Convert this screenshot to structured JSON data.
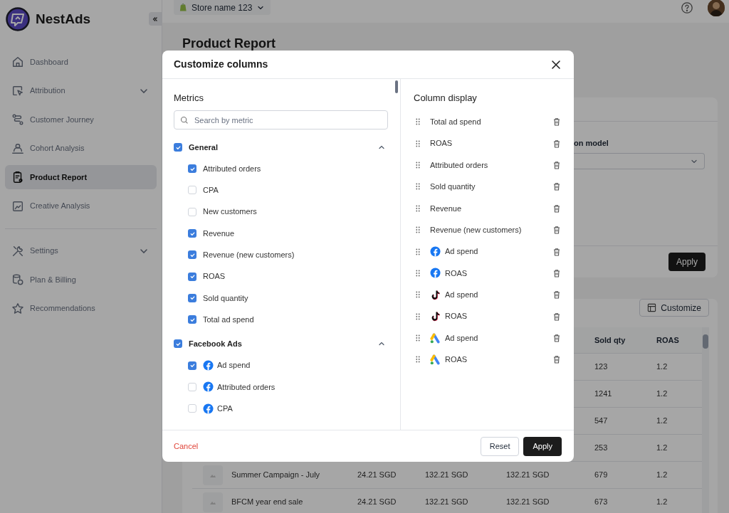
{
  "sidebar": {
    "brand": "NestAds",
    "groups": [
      [
        {
          "label": "Dashboard",
          "selected": false,
          "has_submenu": false
        },
        {
          "label": "Attribution",
          "selected": false,
          "has_submenu": true
        },
        {
          "label": "Customer Journey",
          "selected": false,
          "has_submenu": false
        },
        {
          "label": "Cohort Analysis",
          "selected": false,
          "has_submenu": false
        },
        {
          "label": "Product Report",
          "selected": true,
          "has_submenu": false
        },
        {
          "label": "Creative Analysis",
          "selected": false,
          "has_submenu": false
        }
      ],
      [
        {
          "label": "Settings",
          "selected": false,
          "has_submenu": true
        },
        {
          "label": "Plan & Billing",
          "selected": false,
          "has_submenu": false
        },
        {
          "label": "Recommendations",
          "selected": false,
          "has_submenu": false
        }
      ]
    ]
  },
  "topbar": {
    "store": "Store name 123"
  },
  "page": {
    "title": "Product Report",
    "filter_label": "on model",
    "apply": "Apply",
    "customize": "Customize",
    "table": {
      "columns": [
        "",
        "",
        "",
        "",
        "Sold qty",
        "ROAS"
      ],
      "rows": [
        {
          "cells": [
            "",
            "",
            "",
            "",
            "123",
            "1.2"
          ]
        },
        {
          "cells": [
            "",
            "",
            "",
            "",
            "1241",
            "1.2"
          ]
        },
        {
          "cells": [
            "",
            "",
            "",
            "",
            "547",
            "1.2"
          ]
        },
        {
          "cells": [
            "",
            "",
            "",
            "",
            "253",
            "1.2"
          ]
        },
        {
          "cells": [
            "Summer Campaign - July",
            "24.21 SGD",
            "132.21 SGD",
            "132.21 SGD",
            "679",
            "1.2"
          ]
        },
        {
          "cells": [
            "BFCM year end sale",
            "24.21 SGD",
            "132.21 SGD",
            "132.21 SGD",
            "673",
            "1.2"
          ]
        }
      ]
    }
  },
  "modal": {
    "title": "Customize columns",
    "metrics_heading": "Metrics",
    "search_placeholder": "Search by metric",
    "groups": [
      {
        "label": "General",
        "checked": true,
        "expanded": true,
        "kind": "general",
        "items": [
          {
            "label": "Attributed orders",
            "checked": true
          },
          {
            "label": "CPA",
            "checked": false
          },
          {
            "label": "New customers",
            "checked": false
          },
          {
            "label": "Revenue",
            "checked": true
          },
          {
            "label": "Revenue (new customers)",
            "checked": true
          },
          {
            "label": "ROAS",
            "checked": true
          },
          {
            "label": "Sold quantity",
            "checked": true
          },
          {
            "label": "Total ad spend",
            "checked": true
          }
        ]
      },
      {
        "label": "Facebook Ads",
        "checked": true,
        "expanded": true,
        "kind": "facebook",
        "items": [
          {
            "label": "Ad spend",
            "checked": true
          },
          {
            "label": "Attributed orders",
            "checked": false
          },
          {
            "label": "CPA",
            "checked": false
          }
        ]
      }
    ],
    "display_heading": "Column display",
    "display": [
      {
        "label": "Total ad spend",
        "kind": "general"
      },
      {
        "label": "ROAS",
        "kind": "general"
      },
      {
        "label": "Attributed orders",
        "kind": "general"
      },
      {
        "label": "Sold quantity",
        "kind": "general"
      },
      {
        "label": "Revenue",
        "kind": "general"
      },
      {
        "label": "Revenue (new customers)",
        "kind": "general"
      },
      {
        "label": "Ad spend",
        "kind": "facebook"
      },
      {
        "label": "ROAS",
        "kind": "facebook"
      },
      {
        "label": "Ad spend",
        "kind": "tiktok"
      },
      {
        "label": "ROAS",
        "kind": "tiktok"
      },
      {
        "label": "Ad spend",
        "kind": "google_ads"
      },
      {
        "label": "ROAS",
        "kind": "google_ads"
      }
    ],
    "cancel": "Cancel",
    "reset": "Reset",
    "apply": "Apply"
  }
}
